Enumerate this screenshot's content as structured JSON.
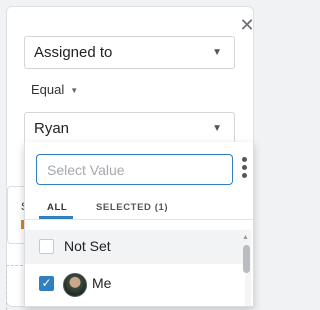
{
  "filter": {
    "field_select": "Assigned to",
    "operator": "Equal",
    "value_select": "Ryan"
  },
  "background": {
    "partial_text": "S"
  },
  "dropdown": {
    "search_placeholder": "Select Value",
    "tabs": [
      {
        "label": "ALL",
        "active": true
      },
      {
        "label": "SELECTED (1)",
        "active": false
      }
    ],
    "options": [
      {
        "label": "Not Set",
        "checked": false
      },
      {
        "label": "Me",
        "checked": true
      }
    ]
  },
  "colors": {
    "accent": "#2f7fc1",
    "option_hover": "#f2f3f5"
  }
}
